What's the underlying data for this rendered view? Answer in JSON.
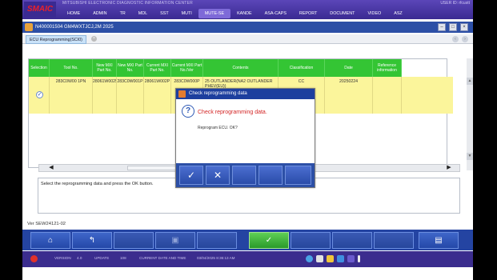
{
  "header": {
    "logo": "SMAIC",
    "app_title": "MITSUBISHI ELECTRONIC DIAGNOSTIC INFORMATION CENTER",
    "user_id": "USER ID: rfcustt",
    "tabs": [
      "HOME",
      "ADMIN",
      "TR",
      "MDL",
      "SST",
      "MUTI",
      "MUTE-SE",
      "KANDE",
      "ASA-CAPS",
      "REPORT",
      "DOCUMENT",
      "VIDEO",
      "ASZ"
    ],
    "active_tab": "MUTE-SE"
  },
  "window": {
    "title": "N400001504  GM4WXTJCJ,2M 2025",
    "tab_label": "ECU Reprogramming(SCI0)"
  },
  "table": {
    "headers": [
      "Selection",
      "Tool No.",
      "New MXI Part No.",
      "New MXI Part No.",
      "Current MXI Part No.",
      "Current MXI Part No./Ver",
      "Contents",
      "Classification",
      "Date",
      "Reference information"
    ],
    "row": {
      "selected": "✓",
      "tool_no": "283C0W00 1PN",
      "new_part": "28061W0025",
      "new_part2": "283C0W001P",
      "cur_part": "28061W002P",
      "cur_part2": "283C0W000P",
      "contents": "25 OUTLANDER(NA2 OUTLANDER PHEV(EU))",
      "classification": "CC",
      "date": "20250224",
      "reference": ""
    }
  },
  "message": "Select the reprogramming data and press the OK button.",
  "version": "Ver SEW24121-02",
  "dialog": {
    "title": "Check reprogramming data",
    "message": "Check reprogramming data.",
    "sub": "Reprogram ECU. OK?",
    "ok": "✓",
    "cancel": "✕"
  },
  "taskbar": {
    "version_label": "VERSION",
    "version_value": "4.0",
    "update_label": "UPDATE",
    "update_value": "108",
    "date_label": "CURRENT DATE AND TIME",
    "date_value": "03/04/2025 8:36:13 AM"
  }
}
